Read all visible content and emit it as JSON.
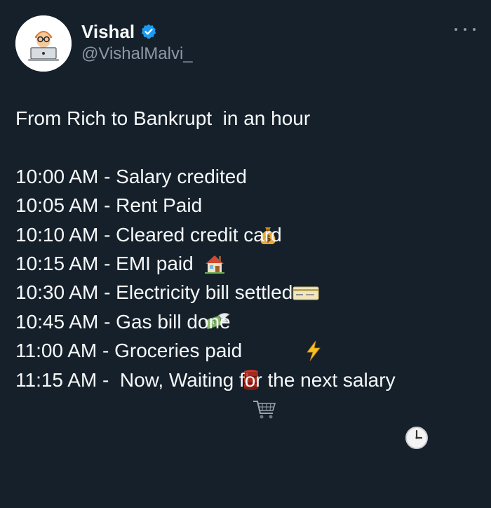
{
  "author": {
    "display_name": "Vishal",
    "handle": "@VishalMalvi_",
    "verified": true,
    "avatar_icon": "developer-at-laptop-icon"
  },
  "tweet": {
    "headline": "From Rich to Bankrupt  in an hour",
    "timeline": [
      {
        "text": "10:00 AM - Salary credited ",
        "emoji": "money-bag-icon"
      },
      {
        "text": "10:05 AM - Rent Paid",
        "emoji": "house-icon"
      },
      {
        "text": "10:10 AM - Cleared credit card ",
        "emoji": "credit-card-icon"
      },
      {
        "text": "10:15 AM - EMI paid ",
        "emoji": "money-with-wings-icon"
      },
      {
        "text": "10:30 AM - Electricity bill settled ",
        "emoji": "high-voltage-icon"
      },
      {
        "text": "10:45 AM - Gas bill done ",
        "emoji": "oil-drum-icon"
      },
      {
        "text": "11:00 AM - Groceries paid ",
        "emoji": "shopping-cart-icon"
      },
      {
        "text": "11:15 AM -  Now, Waiting for the next salary ",
        "emoji": "clock-icon"
      }
    ]
  },
  "colors": {
    "background": "#15202b",
    "text_primary": "#f7f9f9",
    "text_secondary": "#8b98a5",
    "verified_blue": "#1d9bf0"
  },
  "menu": {
    "more_icon": "more-options-icon"
  }
}
